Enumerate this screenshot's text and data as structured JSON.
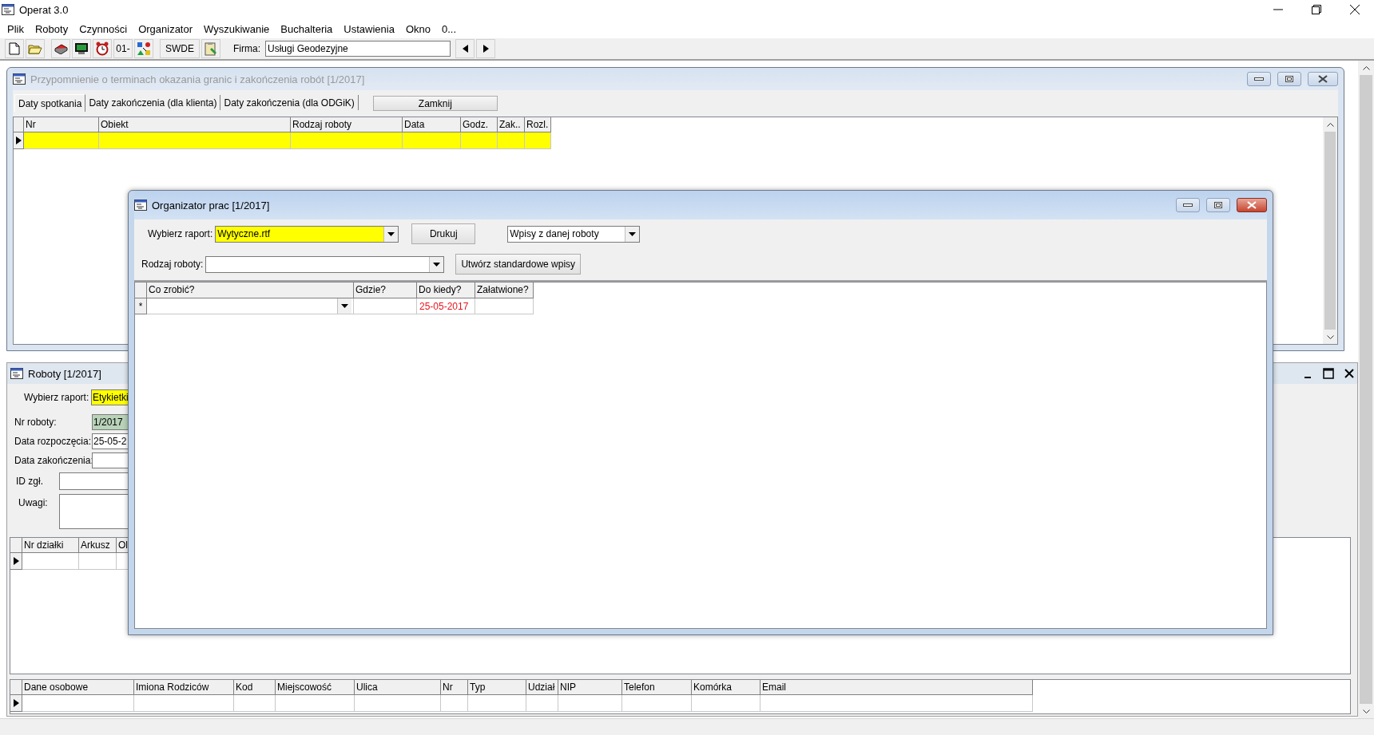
{
  "app_window": {
    "title": "Operat 3.0"
  },
  "menu": [
    "Plik",
    "Roboty",
    "Czynności",
    "Organizator",
    "Wyszukiwanie",
    "Buchalteria",
    "Ustawienia",
    "Okno",
    "0..."
  ],
  "toolbar": {
    "date_button": "01-",
    "swde_button": "SWDE",
    "company_label": "Firma:",
    "company_value": "Usługi Geodezyjne"
  },
  "reminder_window": {
    "title": "Przypomnienie o terminach okazania granic i zakończenia robót [1/2017]",
    "active": false,
    "tabs": [
      {
        "label": "Daty spotkania",
        "selected": true
      },
      {
        "label": "Daty zakończenia (dla klienta)",
        "selected": false
      },
      {
        "label": "Daty zakończenia (dla ODGiK)",
        "selected": false
      }
    ],
    "close_button": "Zamknij",
    "table": {
      "columns": [
        "Nr",
        "Obiekt",
        "Rodzaj roboty",
        "Data",
        "Godz.",
        "Zak..",
        "Rozl."
      ],
      "rows": [
        {
          "selected": true,
          "highlighted": true
        }
      ]
    }
  },
  "roboty_window": {
    "title": "Roboty [1/2017]",
    "report_label": "Wybierz raport:",
    "report_value": "Etykietki",
    "fields": [
      {
        "kind": "inline",
        "label": "Nr roboty:",
        "value": "1/2017",
        "readonly": true
      },
      {
        "kind": "inline",
        "label": "Data rozpoczęcia:",
        "value": "25-05-2",
        "readonly": false
      },
      {
        "kind": "inline",
        "label": "Data zakończenia:",
        "readonly": false
      },
      {
        "kind": "indented",
        "label": "ID zgł.",
        "readonly": false
      },
      {
        "kind": "memo",
        "label": "Uwagi:",
        "readonly": false
      }
    ],
    "plots_table": {
      "columns": [
        "Nr działki",
        "Arkusz",
        "Ol"
      ],
      "rows": [
        {
          "selected": true
        }
      ]
    },
    "owners_table": {
      "columns": [
        "Dane osobowe",
        "Imiona Rodziców",
        "Kod",
        "Miejscowość",
        "Ulica",
        "Nr",
        "Typ",
        "Udział",
        "NIP",
        "Telefon",
        "Komórka",
        "Email"
      ],
      "rows": [
        {
          "selected": true
        }
      ]
    }
  },
  "organizer_window": {
    "title": "Organizator prac [1/2017]",
    "active": true,
    "report_label": "Wybierz raport:",
    "report_value": "Wytyczne.rtf",
    "print_button": "Drukuj",
    "filter_value": "Wpisy z danej roboty",
    "work_type_label": "Rodzaj roboty:",
    "create_button": "Utwórz standardowe wpisy",
    "table": {
      "columns": [
        "Co zrobić?",
        "Gdzie?",
        "Do kiedy?",
        "Załatwione?"
      ],
      "new_row": {
        "marker": "*",
        "due_date": "25-05-2017",
        "overdue": true
      }
    }
  }
}
